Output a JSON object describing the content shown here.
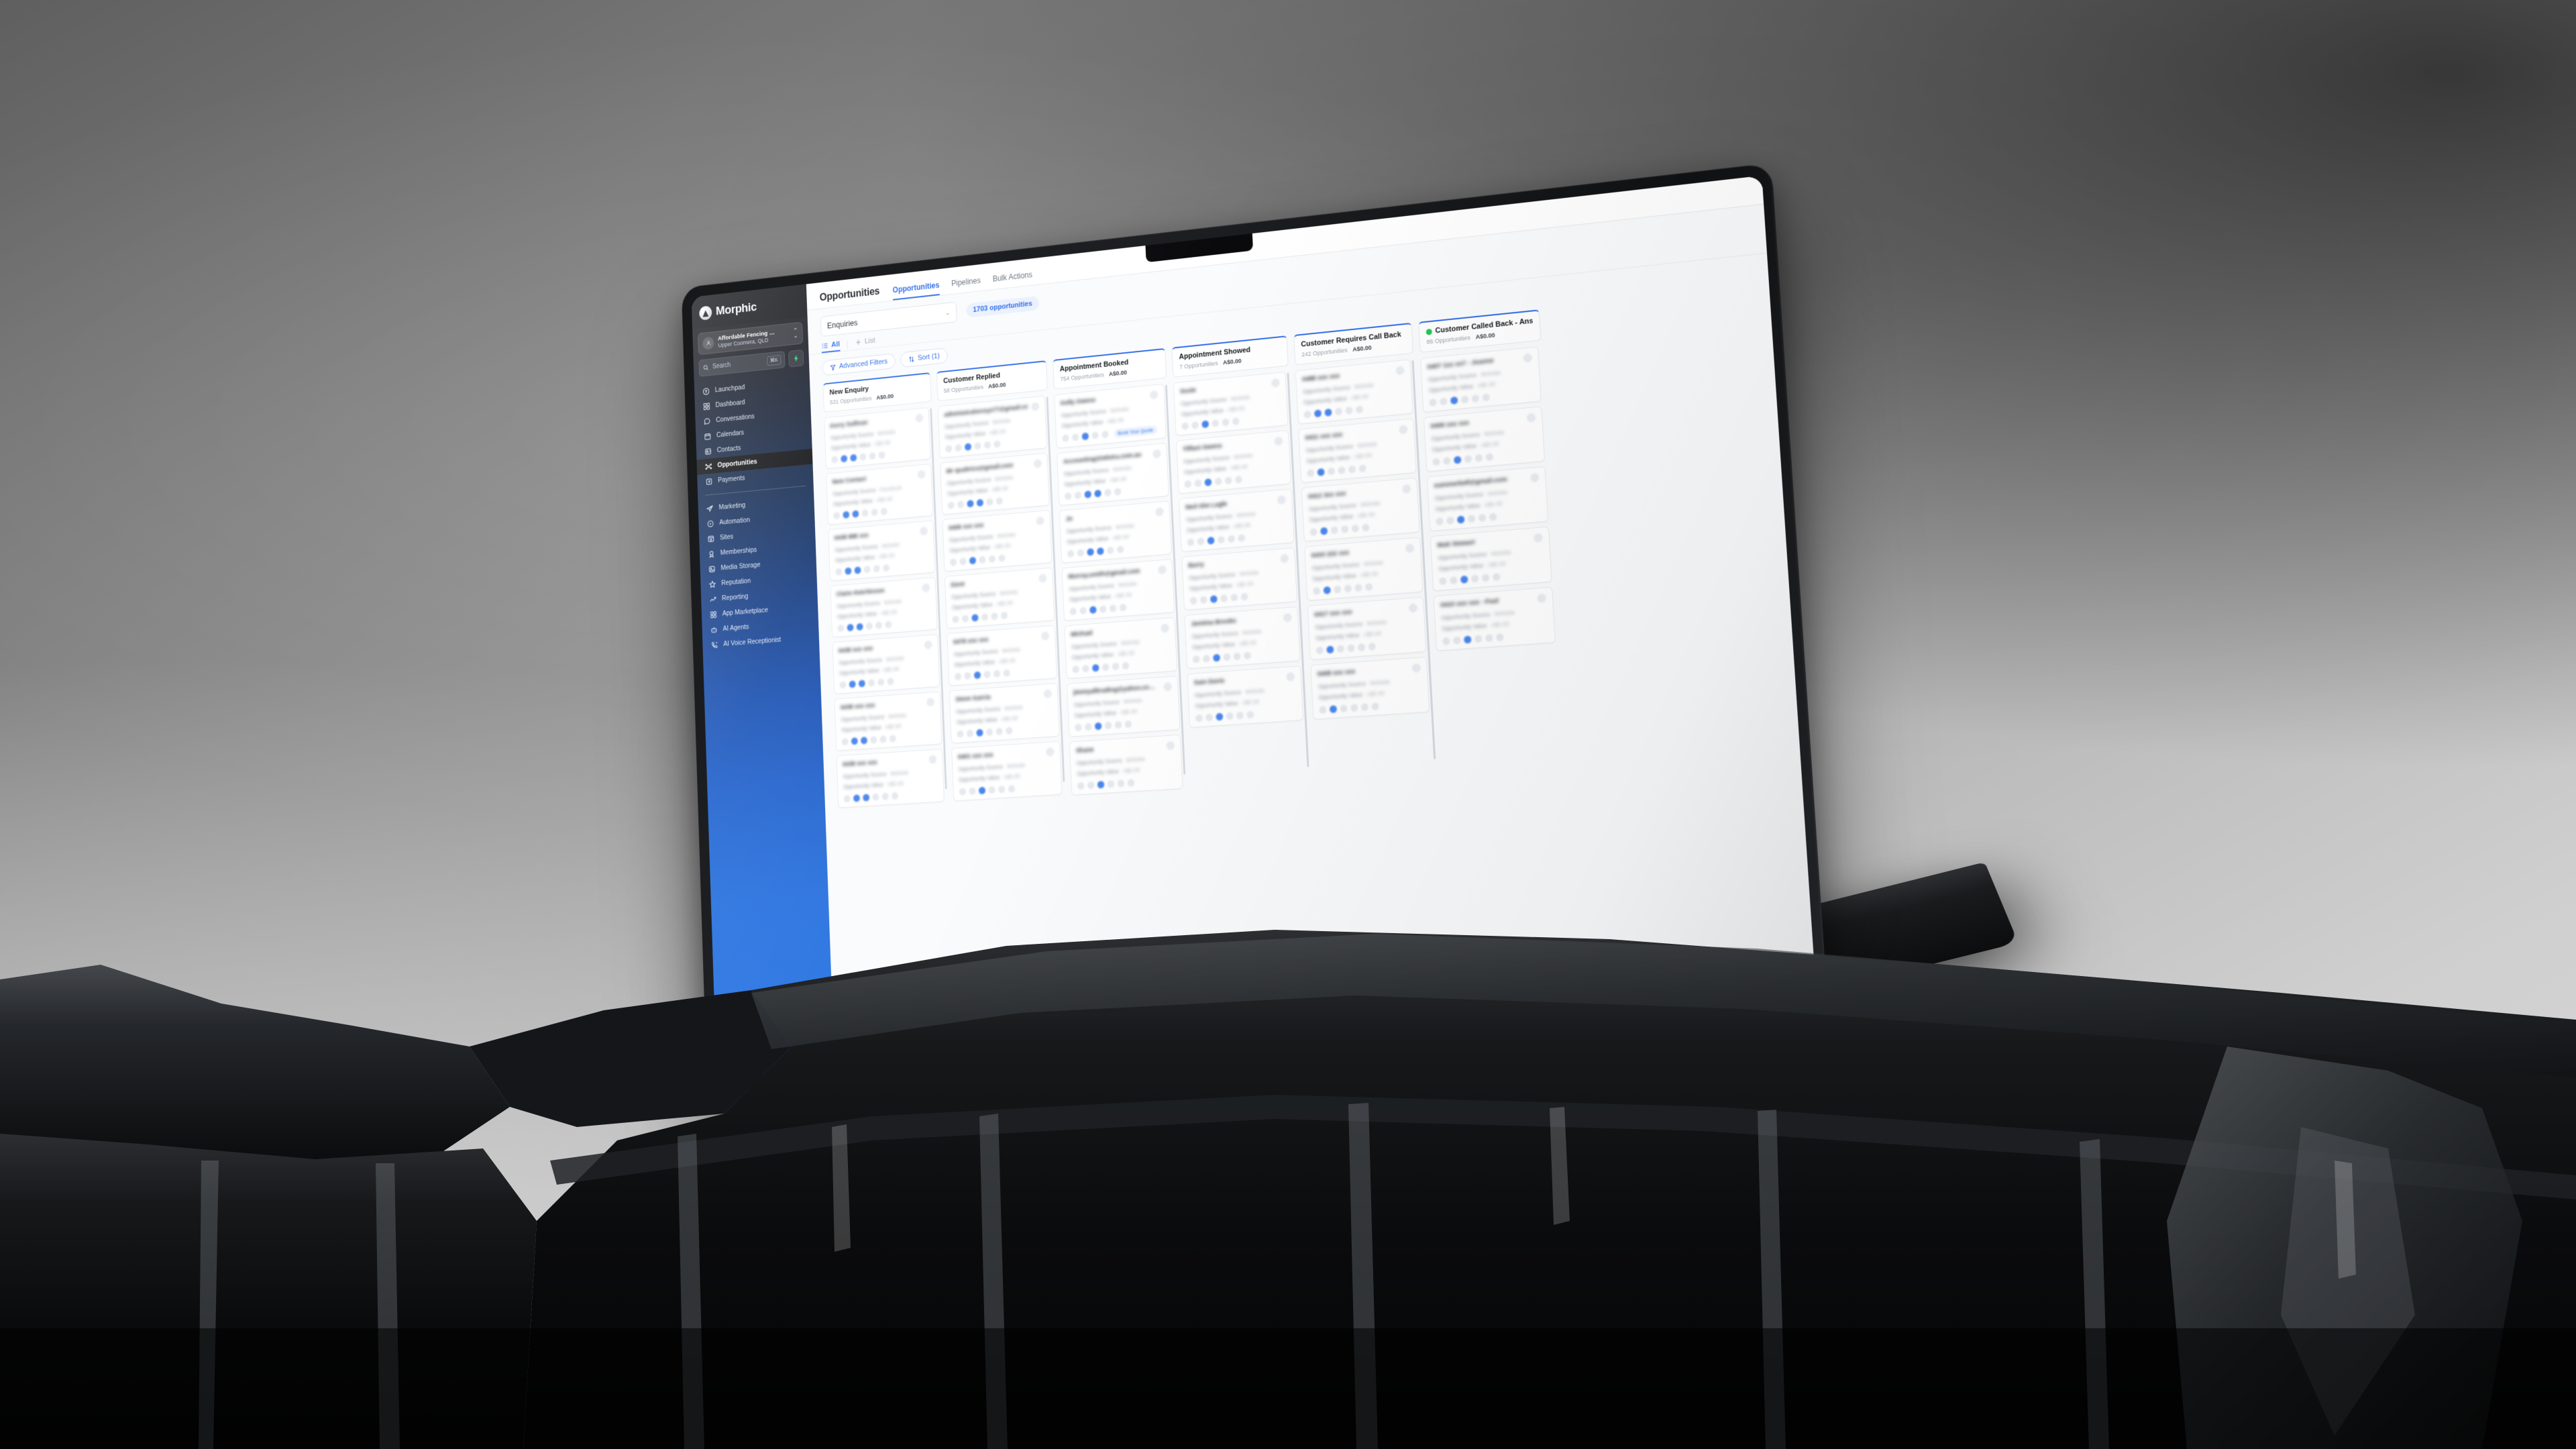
{
  "brand": {
    "name": "Morphic",
    "mark_icon": "morphic-logo-icon"
  },
  "workspace": {
    "name": "Affordable Fencing …",
    "location": "Upper Coomera, QLD",
    "avatar_icon": "workspace-avatar-icon",
    "chevron_icon": "chevron-updown-icon"
  },
  "search": {
    "placeholder": "Search",
    "shortcut": "⌘K",
    "icon": "search-icon"
  },
  "quick_action": {
    "icon": "lightning-bolt-icon",
    "color": "#2ddd6f"
  },
  "sidebar": {
    "items": [
      {
        "label": "Launchpad",
        "icon": "rocket-icon",
        "active": false
      },
      {
        "label": "Dashboard",
        "icon": "grid-icon",
        "active": false
      },
      {
        "label": "Conversations",
        "icon": "chat-bubble-icon",
        "active": false
      },
      {
        "label": "Calendars",
        "icon": "calendar-icon",
        "active": false
      },
      {
        "label": "Contacts",
        "icon": "contact-card-icon",
        "active": false
      },
      {
        "label": "Opportunities",
        "icon": "opportunities-icon",
        "active": true
      },
      {
        "label": "Payments",
        "icon": "payments-icon",
        "active": false
      }
    ],
    "items2": [
      {
        "label": "Marketing",
        "icon": "paper-plane-icon",
        "active": false
      },
      {
        "label": "Automation",
        "icon": "play-circle-icon",
        "active": false
      },
      {
        "label": "Sites",
        "icon": "sites-icon",
        "active": false
      },
      {
        "label": "Memberships",
        "icon": "badge-icon",
        "active": false
      },
      {
        "label": "Media Storage",
        "icon": "image-icon",
        "active": false
      },
      {
        "label": "Reputation",
        "icon": "star-icon",
        "active": false
      },
      {
        "label": "Reporting",
        "icon": "trending-up-icon",
        "active": false
      },
      {
        "label": "App Marketplace",
        "icon": "apps-grid-icon",
        "active": false
      },
      {
        "label": "AI Agents",
        "icon": "robot-icon",
        "active": false
      },
      {
        "label": "AI Voice Receptionist",
        "icon": "phone-wave-icon",
        "active": false
      }
    ],
    "collapse_button": {
      "icon": "chevron-left-icon",
      "glyph": "‹",
      "color": "#23c552"
    }
  },
  "header": {
    "page_title": "Opportunities",
    "tabs": [
      {
        "label": "Opportunities",
        "active": true
      },
      {
        "label": "Pipelines",
        "active": false
      },
      {
        "label": "Bulk Actions",
        "active": false
      }
    ]
  },
  "toolbar": {
    "pipeline_value": "Enquiries",
    "pipeline_chevron_icon": "chevron-down-icon",
    "opportunity_count": "1703 opportunities",
    "view_tabs": [
      {
        "label": "All",
        "icon": "list-view-icon",
        "active": true
      },
      {
        "label": "List",
        "icon": "plus-icon",
        "active": false
      }
    ],
    "filters": [
      {
        "label": "Advanced Filters",
        "icon": "funnel-icon"
      },
      {
        "label": "Sort (1)",
        "icon": "sort-icon"
      }
    ]
  },
  "board": {
    "columns": [
      {
        "title": "New Enquiry",
        "count": "531 Opportunities",
        "value": "A$0.00",
        "dot": false
      },
      {
        "title": "Customer Replied",
        "count": "58 Opportunities",
        "value": "A$0.00",
        "dot": false
      },
      {
        "title": "Appointment Booked",
        "count": "754 Opportunities",
        "value": "A$0.00",
        "dot": false
      },
      {
        "title": "Appointment Showed",
        "count": "7 Opportunities",
        "value": "A$0.00",
        "dot": false
      },
      {
        "title": "Customer Requires Call Back",
        "count": "242 Opportunities",
        "value": "A$0.00",
        "dot": false
      },
      {
        "title": "Customer Called Back - Ans…",
        "count": "86 Opportunities",
        "value": "A$0.00",
        "dot": true,
        "dot_color": "#23c552"
      }
    ],
    "card_field_labels": [
      "Opportunity Source",
      "Opportunity Value"
    ],
    "card_note": "Card contact details are blurred for privacy in this screenshot",
    "card_badge_label": "Book Your Quote"
  },
  "colors": {
    "accent": "#2d6bea",
    "sidebar_top": "#1c1d21",
    "sidebar_bottom": "#2f7ae6",
    "success": "#23c552",
    "bolt_green": "#2ddd6f",
    "page_bg": "#fafbfc"
  }
}
